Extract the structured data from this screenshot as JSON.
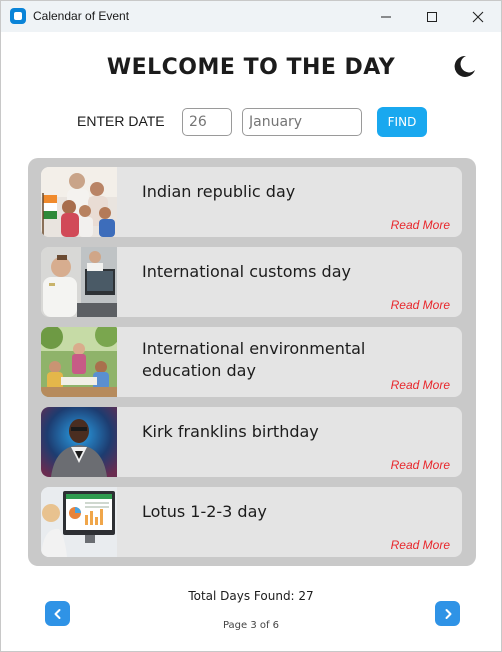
{
  "window": {
    "title": "Calendar of Event"
  },
  "header": {
    "title": "WELCOME TO THE DAY",
    "theme_icon": "moon-icon"
  },
  "search": {
    "label": "ENTER DATE",
    "day_placeholder": "26",
    "month_placeholder": "January",
    "find_label": "FIND"
  },
  "events": [
    {
      "title": "Indian republic day",
      "read_more": "Read More",
      "thumbnail": "family-with-flag-photo"
    },
    {
      "title": "International customs day",
      "read_more": "Read More",
      "thumbnail": "customs-officers-photo"
    },
    {
      "title": "International environmental education day",
      "read_more": "Read More",
      "thumbnail": "outdoor-class-photo"
    },
    {
      "title": "Kirk franklins birthday",
      "read_more": "Read More",
      "thumbnail": "portrait-photo"
    },
    {
      "title": "Lotus 1-2-3 day",
      "read_more": "Read More",
      "thumbnail": "spreadsheet-monitor-photo"
    }
  ],
  "footer": {
    "total_label": "Total Days Found: 27",
    "page_label": "Page 3 of 6"
  },
  "colors": {
    "accent": "#19a8ef",
    "read_more": "#e8262b",
    "nav_button": "#2f93e6",
    "panel": "#c9c9c9",
    "card": "#e4e4e4"
  }
}
